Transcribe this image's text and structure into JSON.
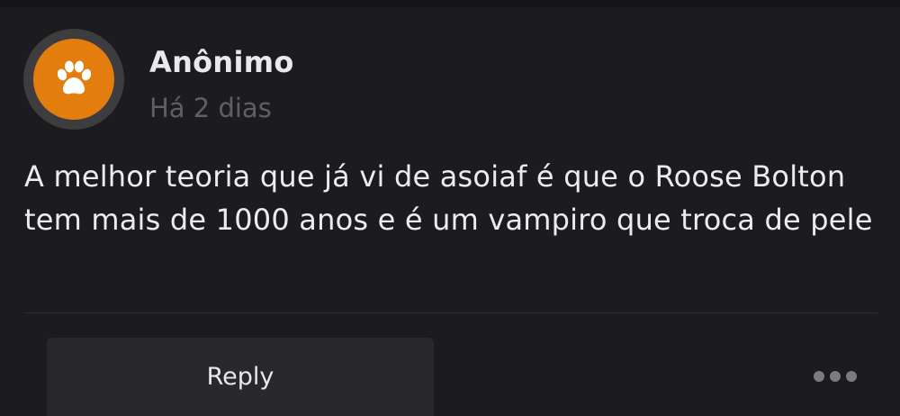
{
  "post": {
    "author": "Anônimo",
    "time": "Há 2 dias",
    "avatar_icon": "paw-icon",
    "avatar_color": "#e37d0e",
    "body": "A melhor teoria que já vi de asoiaf é que o Roose Bolton tem mais de 1000 anos e é um vampiro que troca de pele"
  },
  "actions": {
    "reply_label": "Reply",
    "more_icon": "more-horizontal-icon"
  }
}
